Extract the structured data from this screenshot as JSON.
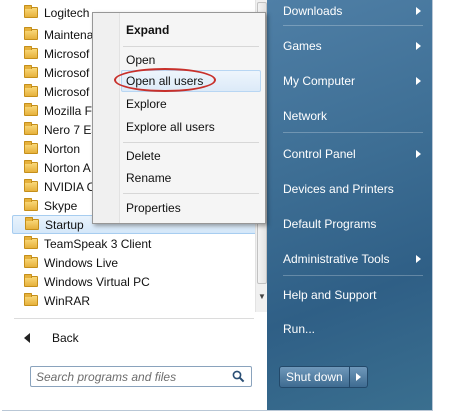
{
  "programs": [
    {
      "label": "Logitech",
      "selected": false
    },
    {
      "label": "Maintena",
      "selected": false
    },
    {
      "label": "Microsof",
      "selected": false
    },
    {
      "label": "Microsof",
      "selected": false
    },
    {
      "label": "Microsof",
      "selected": false
    },
    {
      "label": "Mozilla F",
      "selected": false
    },
    {
      "label": "Nero 7 Es",
      "selected": false
    },
    {
      "label": "Norton",
      "selected": false
    },
    {
      "label": "Norton A",
      "selected": false
    },
    {
      "label": "NVIDIA C",
      "selected": false
    },
    {
      "label": "Skype",
      "selected": false
    },
    {
      "label": "Startup",
      "selected": true
    },
    {
      "label": "TeamSpeak 3 Client",
      "selected": false
    },
    {
      "label": "Windows Live",
      "selected": false
    },
    {
      "label": "Windows Virtual PC",
      "selected": false
    },
    {
      "label": "WinRAR",
      "selected": false
    }
  ],
  "back_label": "Back",
  "search": {
    "placeholder": "Search programs and files"
  },
  "context_menu": {
    "items": [
      "Expand",
      "Open",
      "Open all users",
      "Explore",
      "Explore all users",
      "Delete",
      "Rename",
      "Properties"
    ],
    "highlighted": "Open all users"
  },
  "right_pane": {
    "items": [
      {
        "label": "Downloads",
        "has_arrow": true
      },
      {
        "label": "Games",
        "has_arrow": true
      },
      {
        "label": "My Computer",
        "has_arrow": true
      },
      {
        "label": "Network",
        "has_arrow": false
      },
      {
        "label": "Control Panel",
        "has_arrow": true
      },
      {
        "label": "Devices and Printers",
        "has_arrow": false
      },
      {
        "label": "Default Programs",
        "has_arrow": false
      },
      {
        "label": "Administrative Tools",
        "has_arrow": true
      },
      {
        "label": "Help and Support",
        "has_arrow": false
      },
      {
        "label": "Run...",
        "has_arrow": false
      }
    ]
  },
  "shutdown_label": "Shut down",
  "icons": {
    "folder": "folder-icon",
    "back": "back-arrow-icon",
    "search": "search-icon",
    "submenu": "chevron-right-icon"
  },
  "colors": {
    "right_pane": "#3d6e94",
    "highlight_oval": "#c8302b",
    "selection": "#d4e7f9"
  }
}
